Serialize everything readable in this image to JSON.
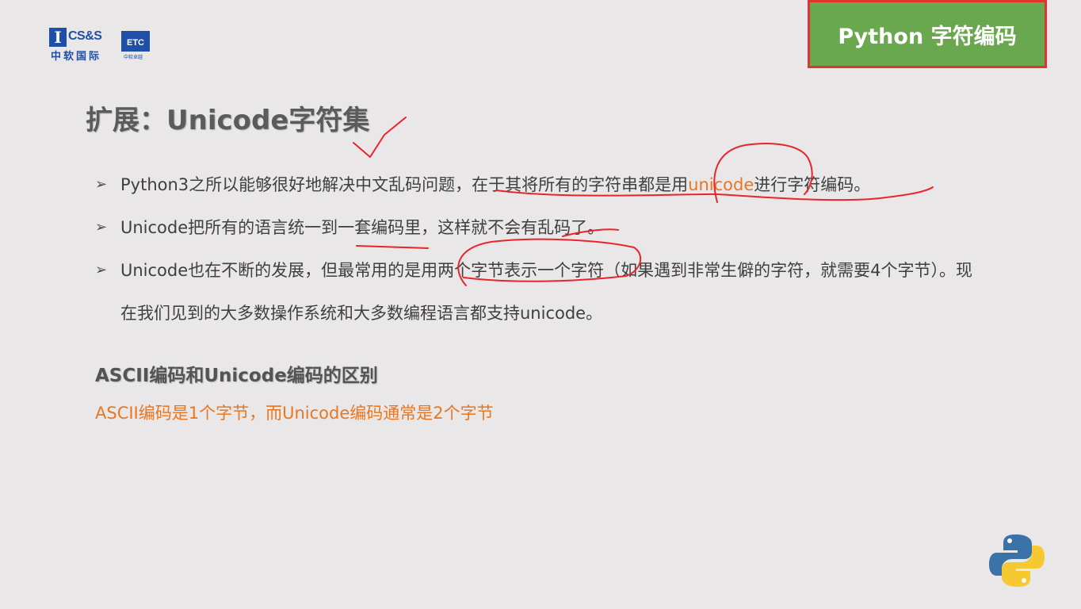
{
  "logo": {
    "mark": "I",
    "cs_text": "CS&S",
    "etc_text": "ETC",
    "cn_text": "中软国际",
    "cn_small": "中软卓越"
  },
  "badge": {
    "label": "Python 字符编码"
  },
  "title": "扩展：Unicode字符集",
  "bullets": [
    {
      "pre": "Python3之所以能够很好地解决中文乱码问题，在于其将所有的字符串都是用",
      "highlight": "unicode",
      "post": "进行字符编码。"
    },
    {
      "pre": "Unicode把所有的语言统一到一套编码里，这样就不会有乱码了。",
      "highlight": "",
      "post": ""
    },
    {
      "pre": "Unicode也在不断的发展，但最常用的是用两个字节表示一个字符（如果遇到非常生僻的字符，就需要4个字节）。现在我们见到的大多数操作系统和大多数编程语言都支持unicode。",
      "highlight": "",
      "post": ""
    }
  ],
  "bullet_marker": "➢",
  "subheading": "ASCII编码和Unicode编码的区别",
  "difference_text": "ASCII编码是1个字节，而Unicode编码通常是2个字节",
  "icons": {
    "corner_logo": "python-logo-icon"
  },
  "colors": {
    "accent_orange": "#e87722",
    "badge_green": "#6aa84f",
    "badge_border": "#e0342e",
    "ink_red": "#e8252b",
    "brand_blue": "#1f4fa6"
  }
}
